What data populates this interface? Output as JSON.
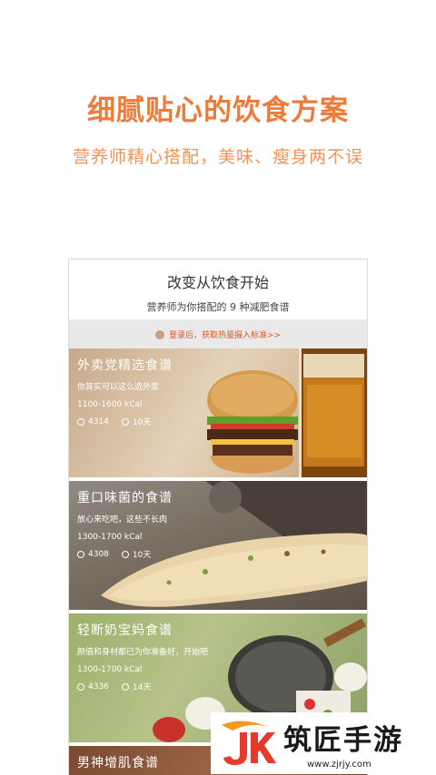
{
  "banner": {
    "headline": "细腻贴心的饮食方案",
    "subline": "营养师精心搭配，美味、瘦身两不误"
  },
  "screen": {
    "title": "改变从饮食开始",
    "subtitle": "营养师为你搭配的 9 种减肥食谱",
    "login_prompt": "登录后，获取热量摄入标准>>"
  },
  "recipes": [
    {
      "name": "外卖党精选食谱",
      "desc": "你其实可以这么选外卖",
      "kcal": "1100-1600 kCal",
      "count": "4314",
      "days": "10天"
    },
    {
      "name": "重口味菌的食谱",
      "desc": "放心来吃吧，这些不长肉",
      "kcal": "1300-1700 kCal",
      "count": "4308",
      "days": "10天"
    },
    {
      "name": "轻断奶宝妈食谱",
      "desc": "颜值和身材都已为你准备好，开始吧",
      "kcal": "1300-1700 kCal",
      "count": "4336",
      "days": "14天"
    },
    {
      "name": "男神增肌食谱"
    }
  ],
  "watermark": {
    "title": "筑匠手游",
    "url": "www.zjrjy.com"
  },
  "colors": {
    "accent": "#ef7b3b",
    "login_text": "#e0562a"
  }
}
